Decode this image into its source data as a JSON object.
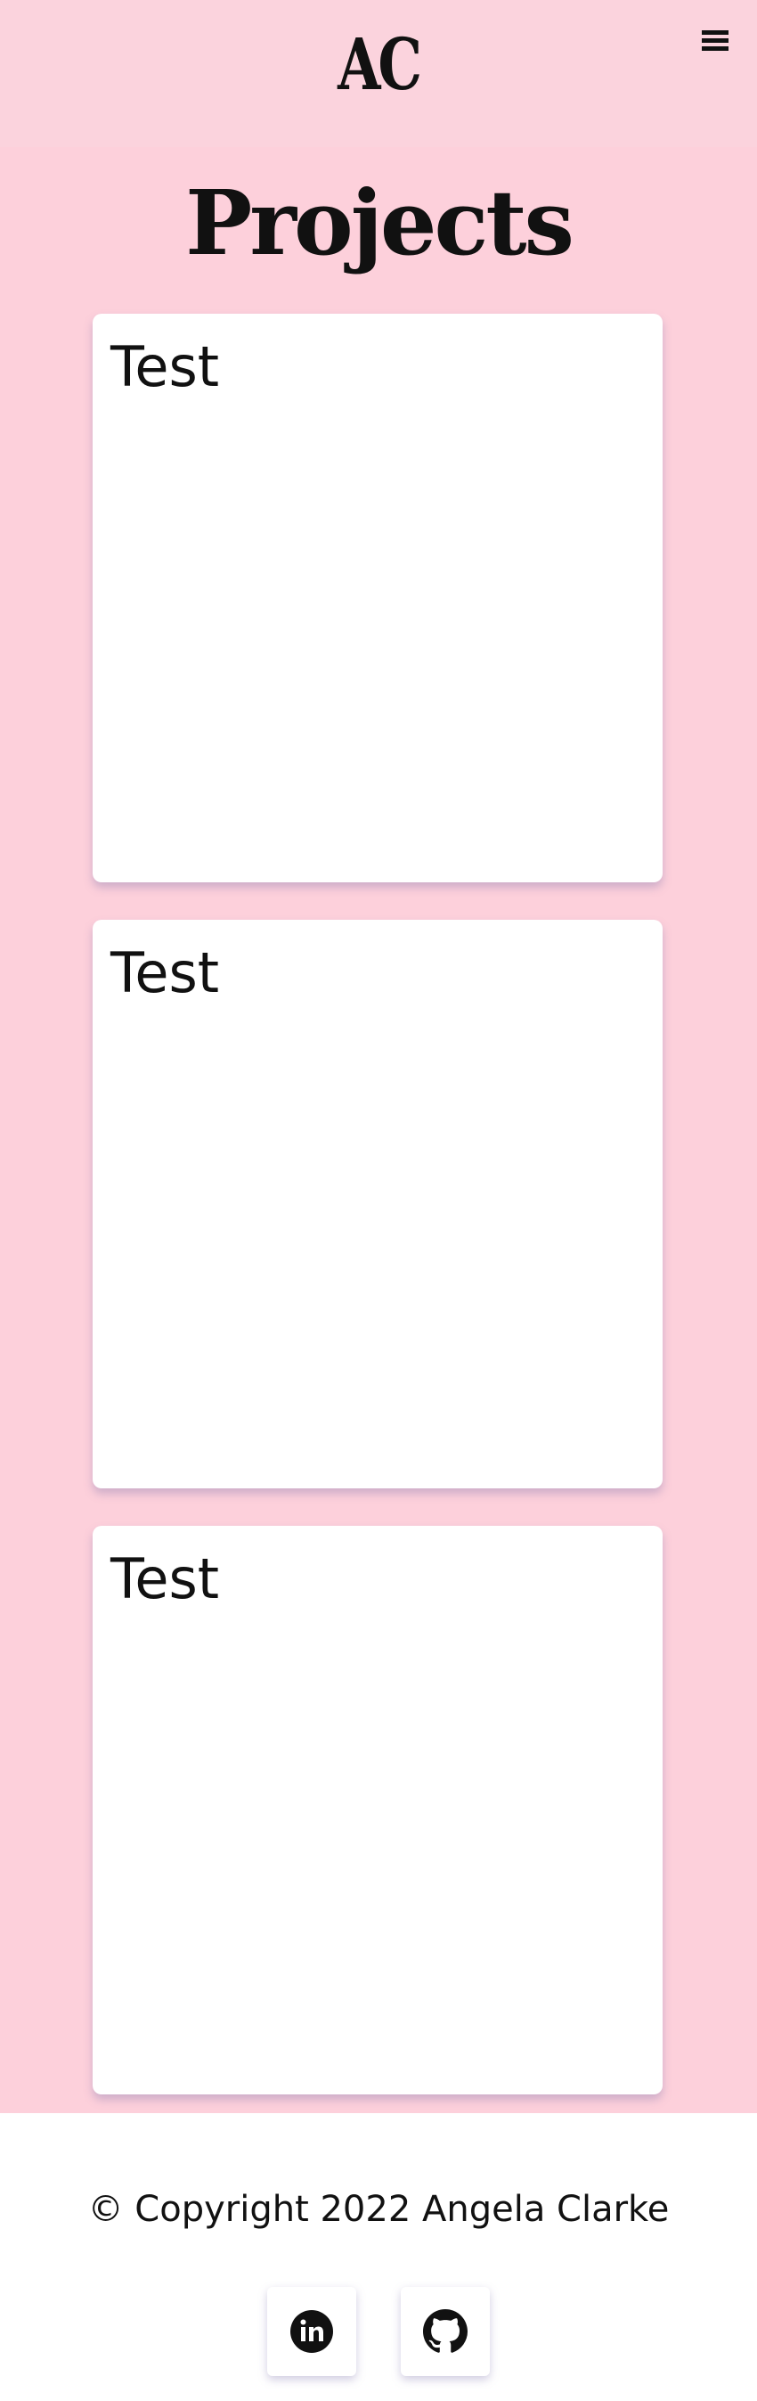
{
  "header": {
    "logo": "AC",
    "menu_icon": "hamburger-menu-icon"
  },
  "main": {
    "title": "Projects",
    "projects": [
      {
        "title": "Test"
      },
      {
        "title": "Test"
      },
      {
        "title": "Test"
      }
    ]
  },
  "footer": {
    "copyright": "© Copyright 2022 Angela Clarke",
    "social": [
      {
        "icon": "linkedin-icon"
      },
      {
        "icon": "github-icon"
      }
    ]
  },
  "colors": {
    "page_background": "#fdd0db",
    "header_background": "#fbd3dd",
    "card_background": "#ffffff",
    "text": "#111111"
  }
}
